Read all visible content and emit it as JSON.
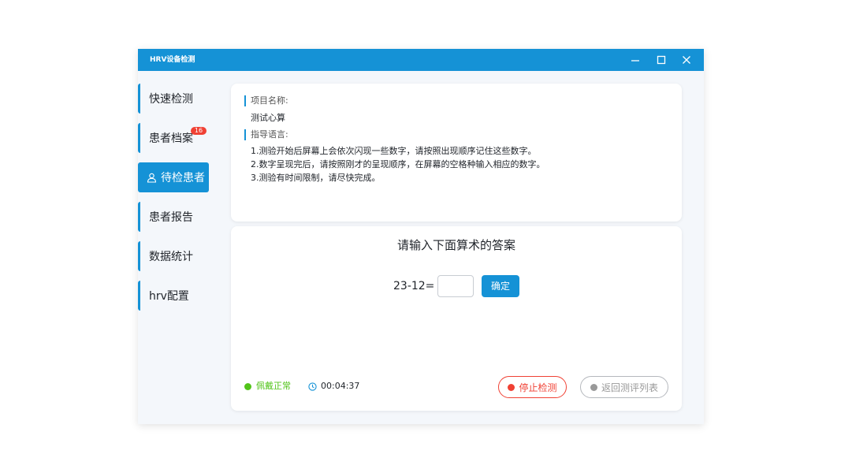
{
  "window": {
    "title": "HRV设备检测",
    "controls": {
      "minimize": "minimize-icon",
      "maximize": "maximize-icon",
      "close": "close-icon"
    }
  },
  "sidebar": {
    "items": [
      {
        "label": "快速检测"
      },
      {
        "label": "患者档案",
        "badge": "16"
      },
      {
        "label": "待检患者",
        "icon": "user-icon",
        "active": true
      },
      {
        "label": "患者报告"
      },
      {
        "label": "数据统计"
      },
      {
        "label": "hrv配置"
      }
    ]
  },
  "info": {
    "project_label": "项目名称:",
    "project_name": "测试心算",
    "guide_label": "指导语言:",
    "guide_lines": [
      "1.测验开始后屏幕上会依次闪现一些数字，请按照出现顺序记住这些数字。",
      "2.数字呈现完后，请按照刚才的呈现顺序，在屏幕的空格种输入相应的数字。",
      "3.测验有时间限制，请尽快完成。"
    ]
  },
  "question": {
    "title": "请输入下面算术的答案",
    "expression": "23-12=",
    "answer_value": "",
    "answer_placeholder": "",
    "confirm_label": "确定"
  },
  "footer": {
    "wear_status": "佩戴正常",
    "wear_color": "#52c41a",
    "timer": "00:04:37",
    "stop_label": "停止检测",
    "stop_color": "#f04134",
    "back_label": "返回测评列表",
    "back_color": "#999999"
  },
  "colors": {
    "accent": "#1592d6",
    "badge": "#f04134"
  }
}
